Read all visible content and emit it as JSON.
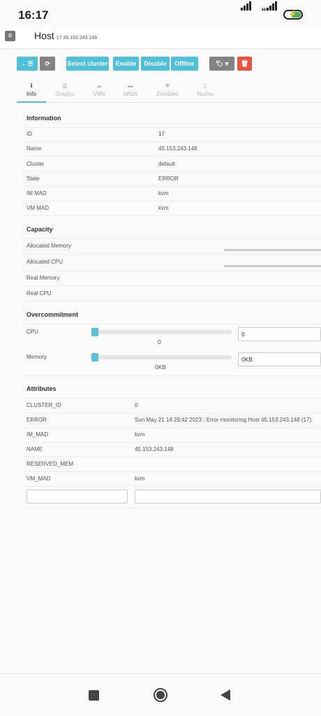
{
  "status_bar": {
    "time": "16:17",
    "network_label": "H+"
  },
  "header": {
    "menu_icon": "menu-icon",
    "title": "Host",
    "subtitle": "17 45.153.243.148"
  },
  "toolbar": {
    "back_label": "←☰",
    "refresh_label": "⟳",
    "select_cluster_label": "Select cluster",
    "enable_label": "Enable",
    "disable_label": "Disable",
    "offline_label": "Offline",
    "labels_label": "🏷 ▾",
    "delete_label": "🗑"
  },
  "tabs": [
    {
      "label": "Info",
      "icon": "info-icon",
      "glyph": "ℹ"
    },
    {
      "label": "Graphs",
      "icon": "bar-chart-icon",
      "glyph": "▥"
    },
    {
      "label": "VMs",
      "icon": "cloud-icon",
      "glyph": "☁"
    },
    {
      "label": "Wilds",
      "icon": "hdd-icon",
      "glyph": "▬"
    },
    {
      "label": "Zombies",
      "icon": "bug-icon",
      "glyph": "✱"
    },
    {
      "label": "Numa",
      "icon": "memory-icon",
      "glyph": "▯"
    }
  ],
  "information": {
    "title": "Information",
    "rows": [
      {
        "label": "ID",
        "value": "17"
      },
      {
        "label": "Name",
        "value": "45.153.243.148"
      },
      {
        "label": "Cluster",
        "value": "default"
      },
      {
        "label": "State",
        "value": "ERROR"
      },
      {
        "label": "IM MAD",
        "value": "kvm"
      },
      {
        "label": "VM MAD",
        "value": "kvm"
      }
    ]
  },
  "capacity": {
    "title": "Capacity",
    "rows": [
      {
        "label": "Allocated Memory"
      },
      {
        "label": "Allocated CPU"
      },
      {
        "label": "Real Memory"
      },
      {
        "label": "Real CPU"
      }
    ]
  },
  "overcommitment": {
    "title": "Overcommitment",
    "cpu": {
      "label": "CPU",
      "slider_value": "0",
      "input_value": "0"
    },
    "memory": {
      "label": "Memory",
      "slider_value": "0KB",
      "input_value": "0KB"
    }
  },
  "attributes": {
    "title": "Attributes",
    "rows": [
      {
        "key": "CLUSTER_ID",
        "value": "0"
      },
      {
        "key": "ERROR",
        "value": "Sun May 21 14:29:42 2023 : Error monitoring Host 45.153.243.148 (17):"
      },
      {
        "key": "IM_MAD",
        "value": "kvm"
      },
      {
        "key": "NAME",
        "value": "45.153.243.148"
      },
      {
        "key": "RESERVED_MEM",
        "value": ""
      },
      {
        "key": "VM_MAD",
        "value": "kvm"
      }
    ],
    "new_key_value": "",
    "new_value_value": ""
  }
}
